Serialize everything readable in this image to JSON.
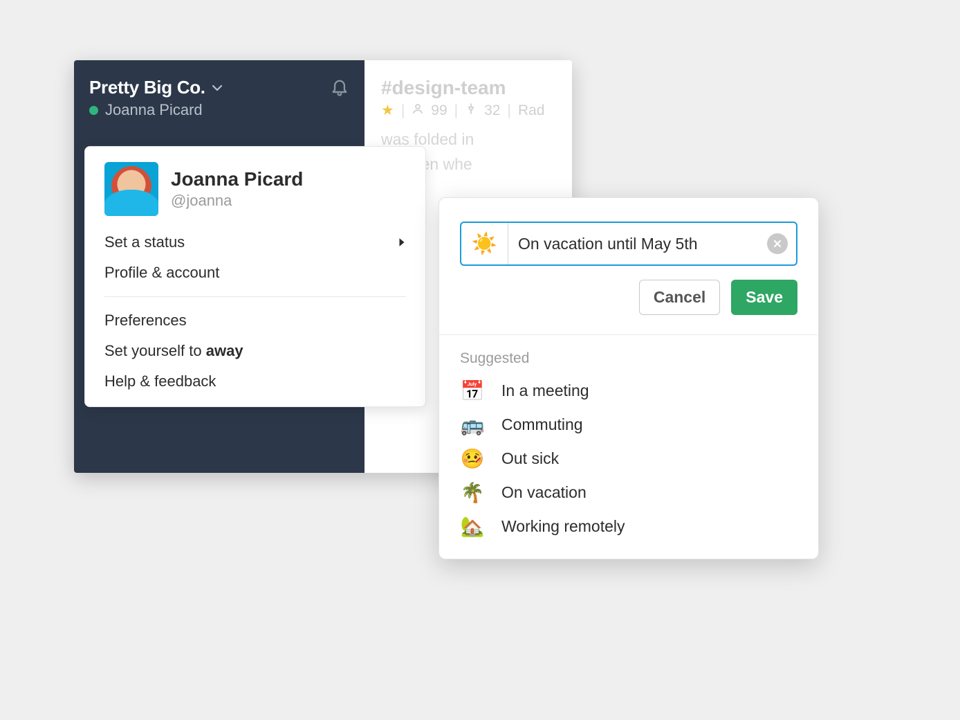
{
  "workspace": {
    "name": "Pretty Big Co.",
    "user_name": "Joanna Picard"
  },
  "channel": {
    "name": "#design-team",
    "members": "99",
    "pins": "32",
    "topic_fragment": "Rad",
    "body_line1": "was folded in",
    "body_line2": "but then whe"
  },
  "menu": {
    "profile_name": "Joanna Picard",
    "profile_handle": "@joanna",
    "items": {
      "set_status": "Set a status",
      "profile_account": "Profile & account",
      "preferences": "Preferences",
      "set_away_prefix": "Set yourself to ",
      "set_away_bold": "away",
      "help_feedback": "Help & feedback"
    }
  },
  "status_modal": {
    "emoji": "☀️",
    "input_value": "On vacation until May 5th",
    "cancel_label": "Cancel",
    "save_label": "Save",
    "suggested_title": "Suggested",
    "suggestions": [
      {
        "emoji": "📅",
        "label": "In a meeting"
      },
      {
        "emoji": "🚌",
        "label": "Commuting"
      },
      {
        "emoji": "🤒",
        "label": "Out sick"
      },
      {
        "emoji": "🌴",
        "label": "On vacation"
      },
      {
        "emoji": "🏡",
        "label": "Working remotely"
      }
    ]
  }
}
